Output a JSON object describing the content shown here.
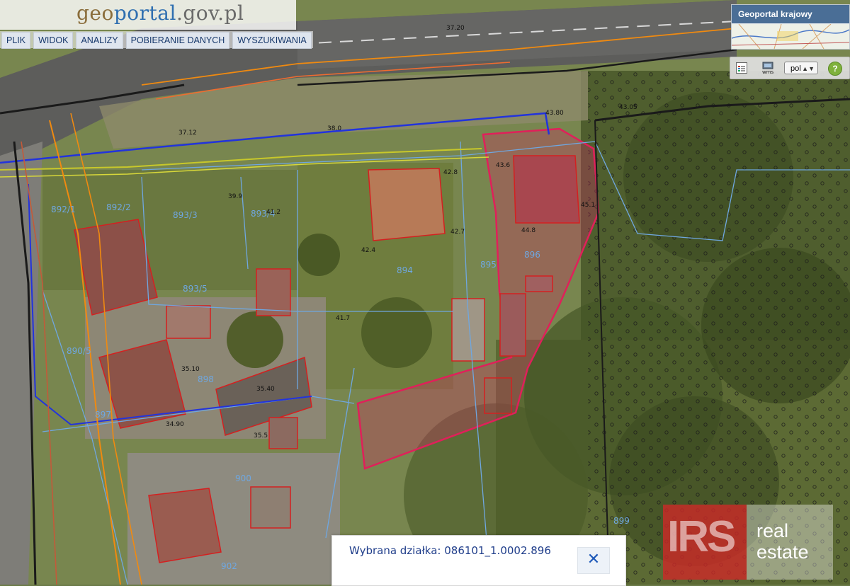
{
  "header": {
    "logo_part1": "geo",
    "logo_part2": "portal",
    "logo_part3": ".gov.pl"
  },
  "menu": {
    "items": [
      {
        "label": "PLIK"
      },
      {
        "label": "WIDOK"
      },
      {
        "label": "ANALIZY"
      },
      {
        "label": "POBIERANIE DANYCH"
      },
      {
        "label": "WYSZUKIWANIA"
      }
    ]
  },
  "overview": {
    "title": "Geoportal krajowy"
  },
  "toolbar": {
    "legend_icon": "legend-icon",
    "wms_icon": "wms-icon",
    "wms_label": "wms",
    "language_value": "pol",
    "help_label": "?"
  },
  "selection": {
    "text": "Wybrana działka: 086101_1.0002.896",
    "close_icon": "close-icon"
  },
  "watermark": {
    "left_text": "IRS",
    "right_line1": "real",
    "right_line2": "estate"
  },
  "map": {
    "parcel_labels": [
      "892/1",
      "893/3",
      "893/4",
      "892/2",
      "893/5",
      "894",
      "895",
      "896",
      "897",
      "898",
      "899",
      "900",
      "902",
      "890/5"
    ],
    "elevation_labels": [
      "37.20",
      "37.12",
      "38.0",
      "39.9",
      "41.2",
      "42.8",
      "42.7",
      "42.4",
      "43.6",
      "43.80",
      "44.8",
      "45.1",
      "43.05",
      "41.7",
      "35.10",
      "35.40",
      "35.5",
      "34.90"
    ],
    "highlight_color": "#e0205a",
    "building_outline_color": "#d42020",
    "utility_blue": "#2233dd",
    "utility_orange": "#f08a10"
  }
}
